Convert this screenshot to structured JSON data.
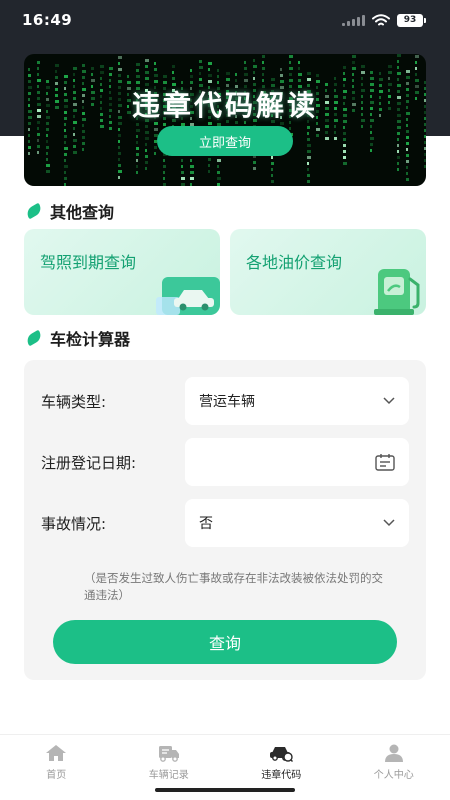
{
  "status": {
    "time": "16:49",
    "battery": "93"
  },
  "banner": {
    "title": "违章代码解读",
    "button_label": "立即查询"
  },
  "other_query": {
    "title": "其他查询",
    "cards": [
      {
        "label": "驾照到期查询",
        "icon": "car-icon"
      },
      {
        "label": "各地油价查询",
        "icon": "fuel-pump-icon"
      }
    ]
  },
  "calculator": {
    "title": "车检计算器",
    "fields": {
      "vehicle_type": {
        "label": "车辆类型:",
        "value": "营运车辆"
      },
      "register_date": {
        "label": "注册登记日期:",
        "value": ""
      },
      "accident": {
        "label": "事故情况:",
        "value": "否"
      }
    },
    "hint": "（是否发生过致人伤亡事故或存在非法改装被依法处罚的交通违法）",
    "submit_label": "查询"
  },
  "tabbar": {
    "items": [
      {
        "label": "首页",
        "icon": "home-icon",
        "active": false
      },
      {
        "label": "车辆记录",
        "icon": "truck-record-icon",
        "active": false
      },
      {
        "label": "违章代码",
        "icon": "car-code-icon",
        "active": true
      },
      {
        "label": "个人中心",
        "icon": "person-icon",
        "active": false
      }
    ]
  },
  "colors": {
    "accent": "#1cbf87",
    "header_dark": "#22262d",
    "card_text": "#14a172"
  }
}
